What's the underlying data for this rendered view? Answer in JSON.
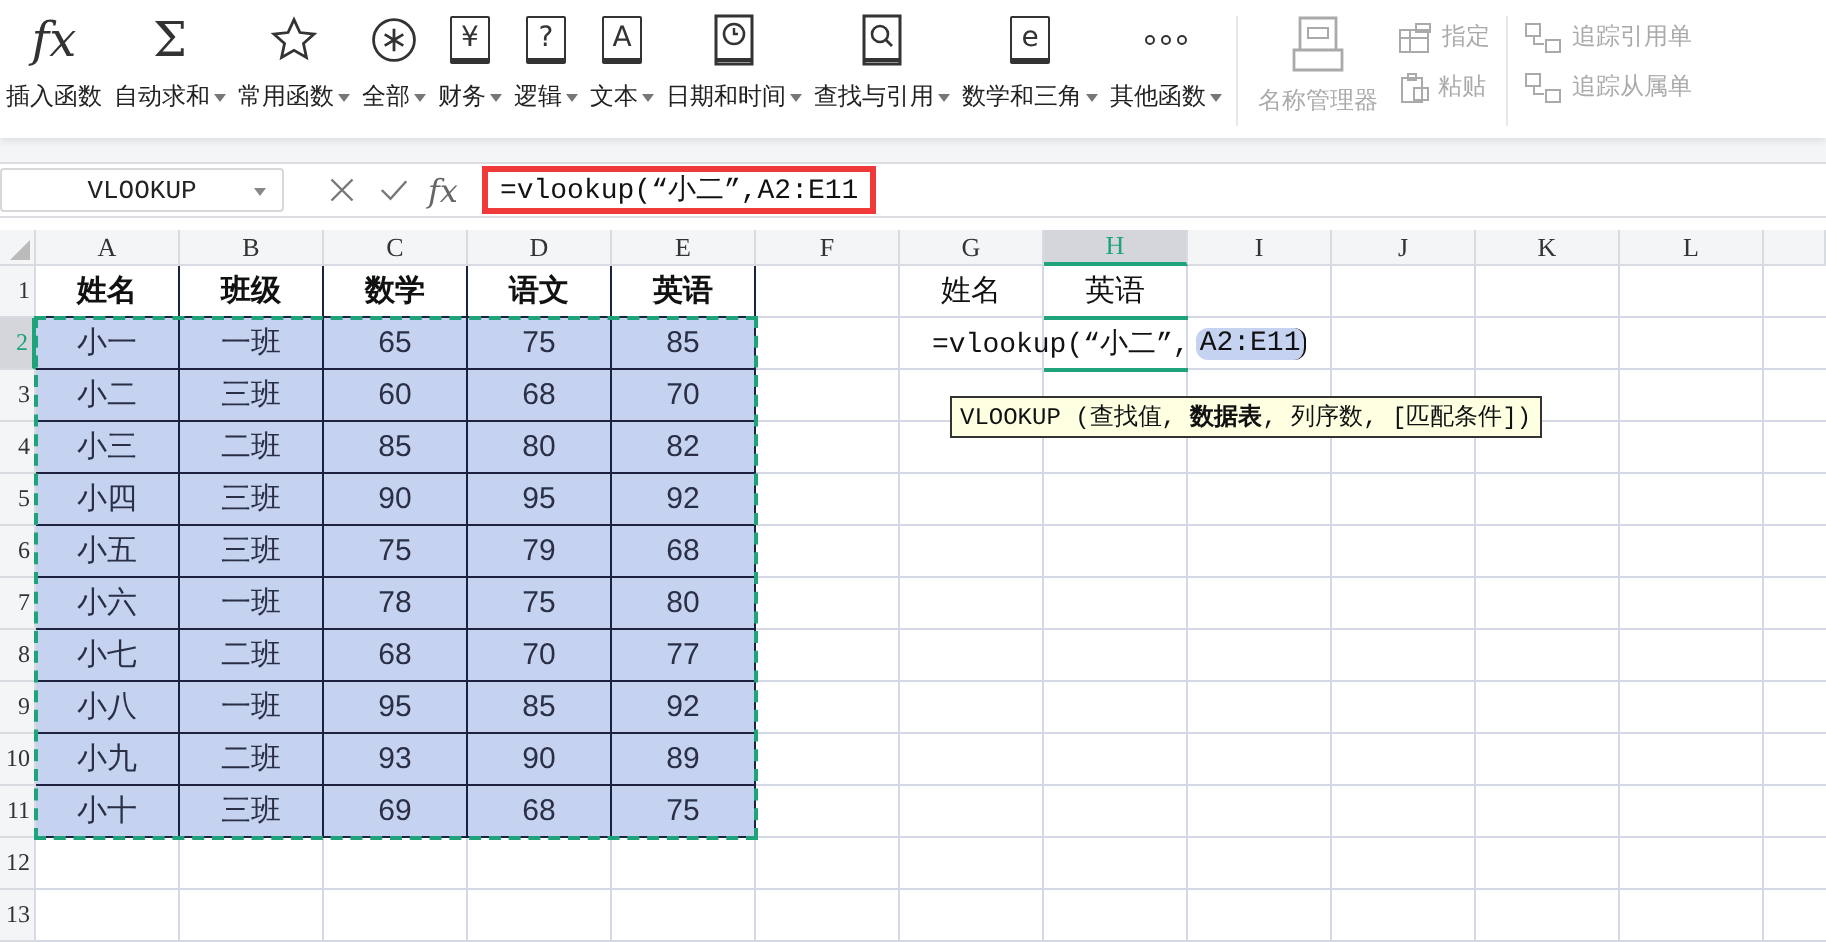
{
  "ribbon": {
    "functions": [
      {
        "label": "插入函数",
        "dropdown": false,
        "kind": "glyph",
        "glyph": "fx"
      },
      {
        "label": "自动求和",
        "dropdown": true,
        "kind": "glyph",
        "glyph": "Σ"
      },
      {
        "label": "常用函数",
        "dropdown": true,
        "kind": "star"
      },
      {
        "label": "全部",
        "dropdown": true,
        "kind": "asterisk"
      },
      {
        "label": "财务",
        "dropdown": true,
        "kind": "book",
        "glyph": "¥"
      },
      {
        "label": "逻辑",
        "dropdown": true,
        "kind": "book",
        "glyph": "?"
      },
      {
        "label": "文本",
        "dropdown": true,
        "kind": "book",
        "glyph": "A"
      },
      {
        "label": "日期和时间",
        "dropdown": true,
        "kind": "clock"
      },
      {
        "label": "查找与引用",
        "dropdown": true,
        "kind": "search"
      },
      {
        "label": "数学和三角",
        "dropdown": true,
        "kind": "book",
        "glyph": "e"
      },
      {
        "label": "其他函数",
        "dropdown": true,
        "kind": "dots"
      }
    ],
    "name_manager": {
      "label": "名称管理器",
      "disabled": true
    },
    "small_buttons": [
      {
        "label": "指定",
        "disabled": true
      },
      {
        "label": "粘贴",
        "disabled": true
      }
    ],
    "trace_buttons": [
      {
        "label": "追踪引用单",
        "disabled": true
      },
      {
        "label": "追踪从属单",
        "disabled": true
      }
    ]
  },
  "formula_bar": {
    "name_box": "VLOOKUP",
    "fx_label": "fx",
    "formula": "=vlookup(“小二”,A2:E11",
    "highlighted": true
  },
  "sheet": {
    "columns": [
      {
        "label": "A",
        "selected": false
      },
      {
        "label": "B",
        "selected": false
      },
      {
        "label": "C",
        "selected": false
      },
      {
        "label": "D",
        "selected": false
      },
      {
        "label": "E",
        "selected": false
      },
      {
        "label": "F",
        "selected": false
      },
      {
        "label": "G",
        "selected": false
      },
      {
        "label": "H",
        "selected": true
      },
      {
        "label": "I",
        "selected": false
      },
      {
        "label": "J",
        "selected": false
      },
      {
        "label": "K",
        "selected": false
      },
      {
        "label": "L",
        "selected": false
      }
    ],
    "rows": [
      {
        "label": "1",
        "selected": false,
        "cells": [
          {
            "text": "姓名",
            "kind": "heading"
          },
          {
            "text": "班级",
            "kind": "heading"
          },
          {
            "text": "数学",
            "kind": "heading"
          },
          {
            "text": "语文",
            "kind": "heading"
          },
          {
            "text": "英语",
            "kind": "heading"
          },
          "",
          {
            "text": "姓名",
            "kind": "plain"
          },
          {
            "text": "英语",
            "kind": "plain"
          }
        ]
      },
      {
        "label": "2",
        "selected": true,
        "cells": [
          {
            "text": "小一",
            "kind": "data"
          },
          {
            "text": "一班",
            "kind": "data"
          },
          {
            "text": "65",
            "kind": "data"
          },
          {
            "text": "75",
            "kind": "data"
          },
          {
            "text": "85",
            "kind": "data"
          },
          "",
          "",
          {
            "text": "=vlookup(“小二”,",
            "reference": "A2:E11",
            "kind": "editing"
          }
        ]
      },
      {
        "label": "3",
        "selected": false,
        "cells": [
          {
            "text": "小二",
            "kind": "data"
          },
          {
            "text": "三班",
            "kind": "data"
          },
          {
            "text": "60",
            "kind": "data"
          },
          {
            "text": "68",
            "kind": "data"
          },
          {
            "text": "70",
            "kind": "data"
          }
        ]
      },
      {
        "label": "4",
        "selected": false,
        "cells": [
          {
            "text": "小三",
            "kind": "data"
          },
          {
            "text": "二班",
            "kind": "data"
          },
          {
            "text": "85",
            "kind": "data"
          },
          {
            "text": "80",
            "kind": "data"
          },
          {
            "text": "82",
            "kind": "data"
          }
        ]
      },
      {
        "label": "5",
        "selected": false,
        "cells": [
          {
            "text": "小四",
            "kind": "data"
          },
          {
            "text": "三班",
            "kind": "data"
          },
          {
            "text": "90",
            "kind": "data"
          },
          {
            "text": "95",
            "kind": "data"
          },
          {
            "text": "92",
            "kind": "data"
          }
        ]
      },
      {
        "label": "6",
        "selected": false,
        "cells": [
          {
            "text": "小五",
            "kind": "data"
          },
          {
            "text": "三班",
            "kind": "data"
          },
          {
            "text": "75",
            "kind": "data"
          },
          {
            "text": "79",
            "kind": "data"
          },
          {
            "text": "68",
            "kind": "data"
          }
        ]
      },
      {
        "label": "7",
        "selected": false,
        "cells": [
          {
            "text": "小六",
            "kind": "data"
          },
          {
            "text": "一班",
            "kind": "data"
          },
          {
            "text": "78",
            "kind": "data"
          },
          {
            "text": "75",
            "kind": "data"
          },
          {
            "text": "80",
            "kind": "data"
          }
        ]
      },
      {
        "label": "8",
        "selected": false,
        "cells": [
          {
            "text": "小七",
            "kind": "data"
          },
          {
            "text": "二班",
            "kind": "data"
          },
          {
            "text": "68",
            "kind": "data"
          },
          {
            "text": "70",
            "kind": "data"
          },
          {
            "text": "77",
            "kind": "data"
          }
        ]
      },
      {
        "label": "9",
        "selected": false,
        "cells": [
          {
            "text": "小八",
            "kind": "data"
          },
          {
            "text": "一班",
            "kind": "data"
          },
          {
            "text": "95",
            "kind": "data"
          },
          {
            "text": "85",
            "kind": "data"
          },
          {
            "text": "92",
            "kind": "data"
          }
        ]
      },
      {
        "label": "10",
        "selected": false,
        "cells": [
          {
            "text": "小九",
            "kind": "data"
          },
          {
            "text": "二班",
            "kind": "data"
          },
          {
            "text": "93",
            "kind": "data"
          },
          {
            "text": "90",
            "kind": "data"
          },
          {
            "text": "89",
            "kind": "data"
          }
        ]
      },
      {
        "label": "11",
        "selected": false,
        "cells": [
          {
            "text": "小十",
            "kind": "data"
          },
          {
            "text": "三班",
            "kind": "data"
          },
          {
            "text": "69",
            "kind": "data"
          },
          {
            "text": "68",
            "kind": "data"
          },
          {
            "text": "75",
            "kind": "data"
          }
        ]
      },
      {
        "label": "12",
        "selected": false,
        "cells": []
      },
      {
        "label": "13",
        "selected": false,
        "cells": []
      }
    ],
    "tooltip": "VLOOKUP (查找值, **数据表**, 列序数, [匹配条件])"
  }
}
